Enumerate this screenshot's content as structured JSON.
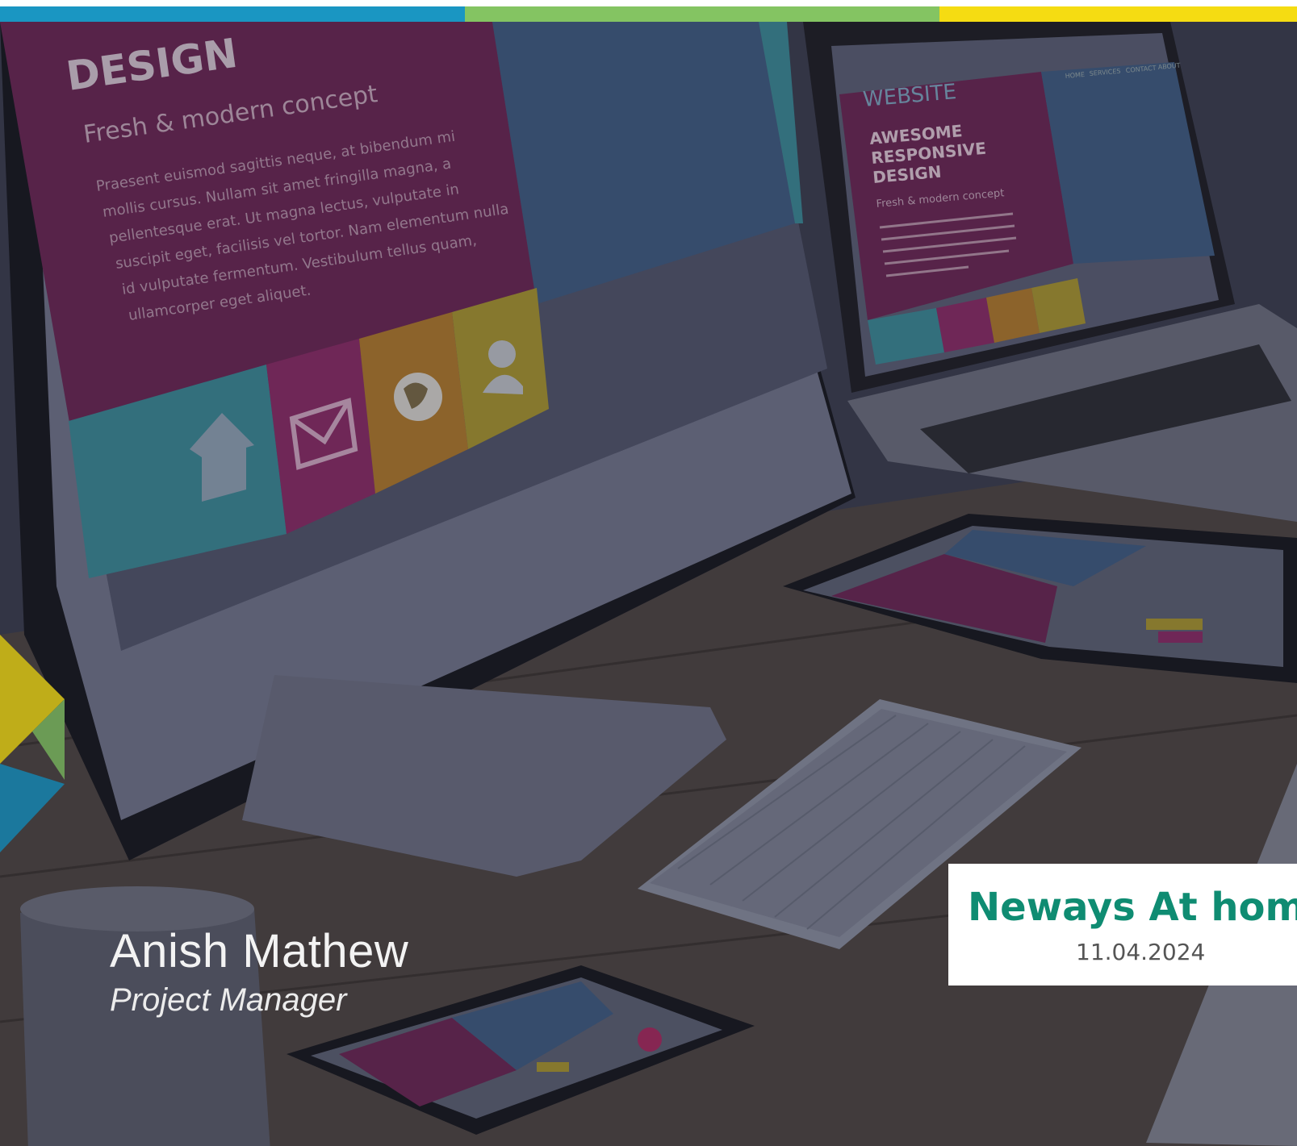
{
  "colors": {
    "stripe_blue": "#1a96c2",
    "stripe_green": "#84c462",
    "stripe_yellow": "#f5dc12",
    "card_title": "#0f8c72",
    "magenta": "#8a1f55",
    "teal": "#3a9aa6",
    "orange": "#c98a2a",
    "mustard": "#b9a131"
  },
  "monitor_screen": {
    "heading": "DESIGN",
    "subheading": "Fresh & modern concept",
    "body_lines": [
      "Praesent euismod sagittis neque, at bibendum mi",
      "mollis cursus. Nullam sit amet fringilla magna, a",
      "pellentesque erat. Ut magna lectus, vulputate in",
      "suscipit eget, facilisis vel tortor. Nam elementum nulla",
      "id vulputate fermentum. Vestibulum tellus quam,",
      "ullamcorper eget aliquet."
    ],
    "tile_icons": [
      "home-icon",
      "mail-icon",
      "globe-icon",
      "user-icon"
    ]
  },
  "laptop_screen": {
    "brand": "WEBSITE",
    "nav": [
      "HOME",
      "SERVICES",
      "CONTACT",
      "ABOUT"
    ],
    "heading_lines": [
      "AWESOME",
      "RESPONSIVE",
      "DESIGN"
    ],
    "subheading": "Fresh & modern concept"
  },
  "presenter": {
    "name": "Anish Mathew",
    "role": "Project Manager"
  },
  "info_card": {
    "title": "Neways At home",
    "date": "11.04.2024"
  }
}
